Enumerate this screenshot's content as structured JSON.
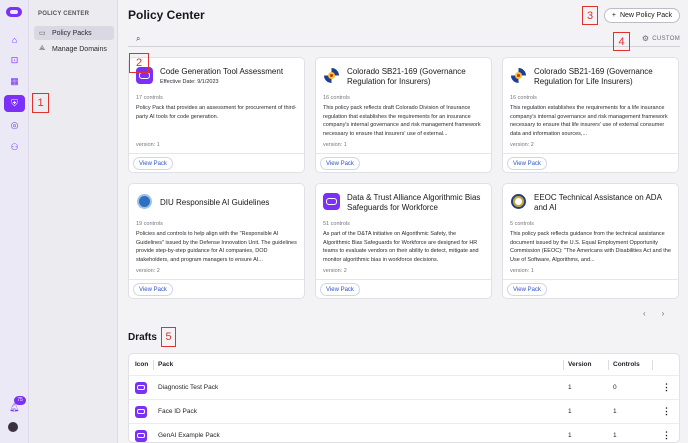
{
  "rail": {
    "badge": "75",
    "items": [
      {
        "icon": "home-icon",
        "glyph": "⌂",
        "active": false
      },
      {
        "icon": "scan-icon",
        "glyph": "⊡",
        "active": false
      },
      {
        "icon": "grid-icon",
        "glyph": "▦",
        "active": false
      },
      {
        "icon": "shield-icon",
        "glyph": "⛨",
        "active": true
      },
      {
        "icon": "target-icon",
        "glyph": "◎",
        "active": false
      },
      {
        "icon": "users-icon",
        "glyph": "⚇",
        "active": false
      }
    ]
  },
  "subnav": {
    "title": "POLICY CENTER",
    "items": [
      {
        "label": "Policy Packs",
        "icon": "archive-icon",
        "glyph": "▭",
        "active": true
      },
      {
        "label": "Manage Domains",
        "icon": "domains-icon",
        "glyph": "⟁",
        "active": false
      }
    ]
  },
  "header": {
    "title": "Policy Center",
    "new_pack_label": "New Policy Pack",
    "new_pack_icon": "+",
    "search_placeholder": "",
    "custom_label": "CUSTOM"
  },
  "cards": [
    {
      "logo": "purple",
      "title": "Code Generation Tool Assessment",
      "subtitle": "Effective Date: 9/1/2023",
      "controls": "17 controls",
      "description": "Policy Pack that provides an assessment for procurement of third-party AI tools for code generation.",
      "version": "version: 1",
      "button": "View Pack"
    },
    {
      "logo": "colorado",
      "title": "Colorado SB21-169 (Governance Regulation for Insurers)",
      "subtitle": "",
      "controls": "16 controls",
      "description": "This policy pack reflects draft Colorado Division of Insurance regulation that establishes the requirements for an insurance company's internal governance and risk management framework necessary to ensure that insurers' use of external...",
      "version": "version: 1",
      "button": "View Pack"
    },
    {
      "logo": "colorado",
      "title": "Colorado SB21-169 (Governance Regulation for Life Insurers)",
      "subtitle": "",
      "controls": "16 controls",
      "description": "This regulation establishes the requirements for a life insurance company's internal governance and risk management framework necessary to ensure that life insurers' use of external consumer data and information sources,...",
      "version": "version: 2",
      "button": "View Pack"
    },
    {
      "logo": "diu",
      "title": "DIU Responsible AI Guidelines",
      "subtitle": "",
      "controls": "19 controls",
      "description": "Policies and controls to help align with the \"Responsible AI Guidelines\" issued by the Defense Innovation Unit. The guidelines provide step-by-step guidance for AI companies, DOD stakeholders, and program managers to ensure AI...",
      "version": "version: 2",
      "button": "View Pack"
    },
    {
      "logo": "purple",
      "title": "Data & Trust Alliance Algorithmic Bias Safeguards for Workforce",
      "subtitle": "",
      "controls": "51 controls",
      "description": "As part of the D&TA initiative on Algorithmic Safety, the Algorithmic Bias Safeguards for Workforce are designed for HR teams to evaluate vendors on their ability to detect, mitigate and monitor algorithmic bias in workforce decisions.",
      "version": "version: 2",
      "button": "View Pack"
    },
    {
      "logo": "eeoc",
      "title": "EEOC Technical Assistance on ADA and AI",
      "subtitle": "",
      "controls": "5 controls",
      "description": "This policy pack reflects guidance from the technical assistance document issued by the U.S. Equal Employment Opportunity Commission (EEOC): \"The Americans with Disabilities Act and the Use of Software, Algorithms, and...",
      "version": "version: 1",
      "button": "View Pack"
    }
  ],
  "pager": {
    "prev": "‹",
    "next": "›"
  },
  "drafts": {
    "title": "Drafts",
    "columns": {
      "icon": "Icon",
      "pack": "Pack",
      "version": "Version",
      "controls": "Controls"
    },
    "rows": [
      {
        "pack": "Diagnostic Test Pack",
        "version": "1",
        "controls": "0",
        "menu": "⋮"
      },
      {
        "pack": "Face ID Pack",
        "version": "1",
        "controls": "1",
        "menu": "⋮"
      },
      {
        "pack": "GenAI Example Pack",
        "version": "1",
        "controls": "1",
        "menu": "⋮"
      }
    ]
  },
  "annotations": [
    "1",
    "2",
    "3",
    "4",
    "5"
  ],
  "colors": {
    "accent": "#7b2ff7",
    "link": "#2e53c8",
    "annotation": "#e0312d"
  }
}
